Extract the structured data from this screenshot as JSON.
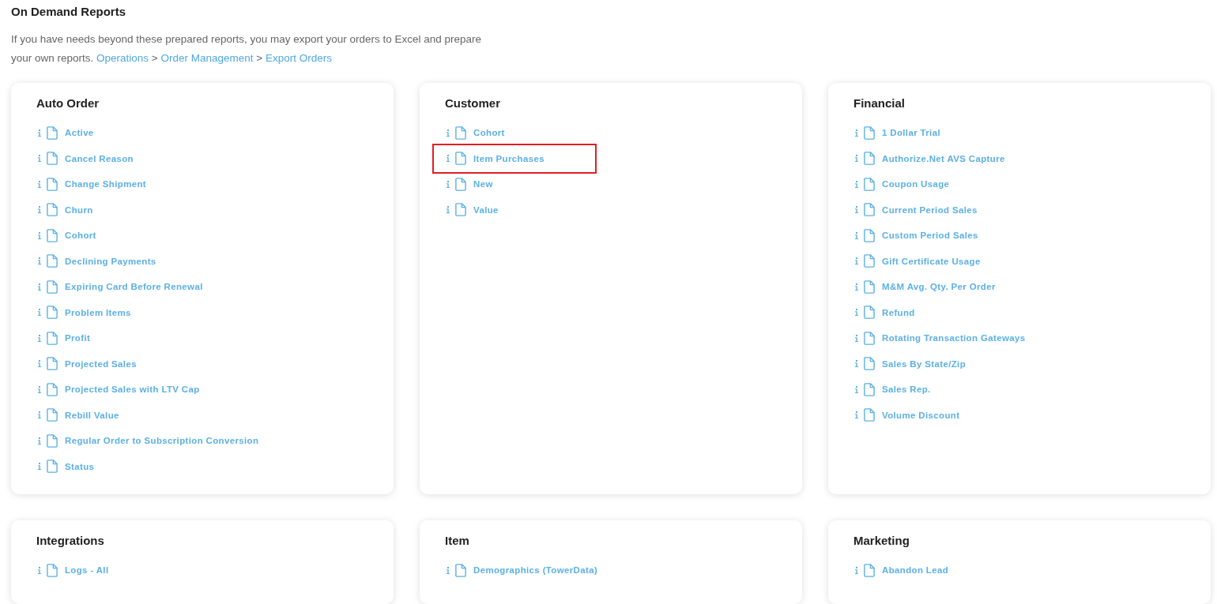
{
  "page": {
    "title": "On Demand Reports",
    "intro": {
      "text": "If you have needs beyond these prepared reports, you may export your orders to Excel and prepare your own reports.",
      "breadcrumb": [
        {
          "kind": "link",
          "text": "Operations"
        },
        {
          "kind": "separator",
          "text": ">"
        },
        {
          "kind": "link",
          "text": "Order Management"
        },
        {
          "kind": "separator",
          "text": ">"
        },
        {
          "kind": "link",
          "text": "Export Orders"
        }
      ]
    }
  },
  "sections": [
    {
      "title": "Auto Order",
      "items": [
        {
          "label": "Active",
          "highlighted": false
        },
        {
          "label": "Cancel Reason",
          "highlighted": false
        },
        {
          "label": "Change Shipment",
          "highlighted": false
        },
        {
          "label": "Churn",
          "highlighted": false
        },
        {
          "label": "Cohort",
          "highlighted": false
        },
        {
          "label": "Declining Payments",
          "highlighted": false
        },
        {
          "label": "Expiring Card Before Renewal",
          "highlighted": false
        },
        {
          "label": "Problem Items",
          "highlighted": false
        },
        {
          "label": "Profit",
          "highlighted": false
        },
        {
          "label": "Projected Sales",
          "highlighted": false
        },
        {
          "label": "Projected Sales with LTV Cap",
          "highlighted": false
        },
        {
          "label": "Rebill Value",
          "highlighted": false
        },
        {
          "label": "Regular Order to Subscription Conversion",
          "highlighted": false
        },
        {
          "label": "Status",
          "highlighted": false
        }
      ]
    },
    {
      "title": "Customer",
      "items": [
        {
          "label": "Cohort",
          "highlighted": false
        },
        {
          "label": "Item Purchases",
          "highlighted": true
        },
        {
          "label": "New",
          "highlighted": false
        },
        {
          "label": "Value",
          "highlighted": false
        }
      ]
    },
    {
      "title": "Financial",
      "items": [
        {
          "label": "1 Dollar Trial",
          "highlighted": false
        },
        {
          "label": "Authorize.Net AVS Capture",
          "highlighted": false
        },
        {
          "label": "Coupon Usage",
          "highlighted": false
        },
        {
          "label": "Current Period Sales",
          "highlighted": false
        },
        {
          "label": "Custom Period Sales",
          "highlighted": false
        },
        {
          "label": "Gift Certificate Usage",
          "highlighted": false
        },
        {
          "label": "M&M Avg. Qty. Per Order",
          "highlighted": false
        },
        {
          "label": "Refund",
          "highlighted": false
        },
        {
          "label": "Rotating Transaction Gateways",
          "highlighted": false
        },
        {
          "label": "Sales By State/Zip",
          "highlighted": false
        },
        {
          "label": "Sales Rep.",
          "highlighted": false
        },
        {
          "label": "Volume Discount",
          "highlighted": false
        }
      ]
    },
    {
      "title": "Integrations",
      "items": [
        {
          "label": "Logs - All",
          "highlighted": false
        }
      ]
    },
    {
      "title": "Item",
      "items": [
        {
          "label": "Demographics (TowerData)",
          "highlighted": false
        }
      ]
    },
    {
      "title": "Marketing",
      "items": [
        {
          "label": "Abandon Lead",
          "highlighted": false
        }
      ]
    }
  ]
}
